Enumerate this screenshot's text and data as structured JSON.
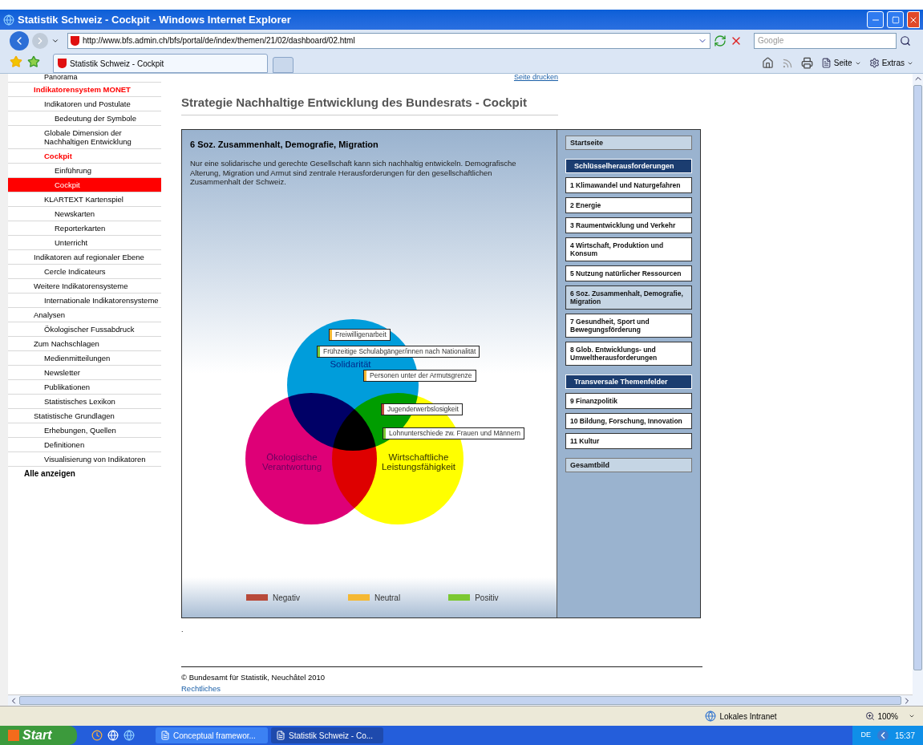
{
  "window": {
    "title": "Statistik Schweiz - Cockpit - Windows Internet Explorer"
  },
  "address_bar": {
    "url": "http://www.bfs.admin.ch/bfs/portal/de/index/themen/21/02/dashboard/02.html",
    "search_placeholder": "Google"
  },
  "tabs": [
    {
      "label": "Statistik Schweiz - Cockpit",
      "selected": true
    }
  ],
  "command_bar": [
    "Seite",
    "Extras"
  ],
  "page": {
    "print_link": "Seite drucken",
    "title": "Strategie Nachhaltige Entwicklung des Bundesrats - Cockpit",
    "sidebar": {
      "clipped_item": "Panorama",
      "items": [
        {
          "label": "Indikatorensystem MONET",
          "selected": false,
          "children": [
            {
              "label": "Indikatoren und Postulate",
              "selected": false,
              "children": [
                {
                  "label": "Bedeutung der Symbole",
                  "selected": false
                }
              ]
            },
            {
              "label": "Globale Dimension der Nachhaltigen Entwicklung",
              "selected": false
            },
            {
              "label": "Cockpit",
              "selected": false,
              "children": [
                {
                  "label": "Einführung",
                  "selected": false
                },
                {
                  "label": "Cockpit",
                  "selected": true
                }
              ]
            },
            {
              "label": "KLARTEXT Kartenspiel",
              "selected": false,
              "children": [
                {
                  "label": "Newskarten",
                  "selected": false
                },
                {
                  "label": "Reporterkarten",
                  "selected": false
                },
                {
                  "label": "Unterricht",
                  "selected": false
                }
              ]
            }
          ]
        },
        {
          "label": "Indikatoren auf regionaler Ebene",
          "selected": false,
          "children": [
            {
              "label": "Cercle Indicateurs",
              "selected": false
            }
          ]
        },
        {
          "label": "Weitere Indikatorensysteme",
          "selected": false,
          "children": [
            {
              "label": "Internationale Indikatorensysteme",
              "selected": false
            }
          ]
        },
        {
          "label": "Analysen",
          "selected": false,
          "children": [
            {
              "label": "Ökologischer Fussabdruck",
              "selected": false
            }
          ]
        },
        {
          "label": "Zum Nachschlagen",
          "selected": false,
          "children": [
            {
              "label": "Medienmitteilungen",
              "selected": false
            },
            {
              "label": "Newsletter",
              "selected": false
            },
            {
              "label": "Publikationen",
              "selected": false
            },
            {
              "label": "Statistisches Lexikon",
              "selected": false
            }
          ]
        },
        {
          "label": "Statistische Grundlagen",
          "selected": false,
          "children": [
            {
              "label": "Erhebungen, Quellen",
              "selected": false
            },
            {
              "label": "Definitionen",
              "selected": false
            },
            {
              "label": "Visualisierung von Indikatoren",
              "selected": false
            }
          ]
        }
      ],
      "show_all": "Alle anzeigen"
    },
    "cockpit": {
      "heading": "6 Soz. Zusammenhalt, Demografie, Migration",
      "description": "Nur eine solidarische und gerechte Gesellschaft kann sich nachhaltig entwickeln. Demografische Alterung, Migration und Armut sind zentrale Herausforderungen für den gesellschaftlichen Zusammenhalt der Schweiz.",
      "venn": {
        "circles": [
          {
            "label_lines": [
              "Solidarität"
            ],
            "color": "#009ddb"
          },
          {
            "label_lines": [
              "Ökologische",
              "Verantwortung"
            ],
            "color": "#de0077"
          },
          {
            "label_lines": [
              "Wirtschaftliche",
              "Leistungsfähigkeit"
            ],
            "color": "#ffff00"
          }
        ],
        "indicators": [
          {
            "label": "Freiwilligenarbeit",
            "color": "#f5b833"
          },
          {
            "label": "Frühzeitige Schulabgänger/innen nach Nationalität",
            "color": "#7cc832"
          },
          {
            "label": "Personen unter der Armutsgrenze",
            "color": "#f5b833"
          },
          {
            "label": "Jugenderwerbslosigkeit",
            "color": "#b84a3a"
          },
          {
            "label": "Lohnunterschiede zw. Frauen und Männern",
            "color": "#7cc832"
          }
        ]
      },
      "legend": [
        {
          "label": "Negativ",
          "color": "#b84a3a"
        },
        {
          "label": "Neutral",
          "color": "#f5b833"
        },
        {
          "label": "Positiv",
          "color": "#7cc832"
        }
      ],
      "nav": [
        {
          "kind": "button",
          "label": "Startseite",
          "selected": false
        },
        {
          "kind": "heading",
          "label": "Schlüsselherausforderungen",
          "selected": false
        },
        {
          "kind": "topic",
          "label": "1 Klimawandel und Naturgefahren",
          "selected": false
        },
        {
          "kind": "topic",
          "label": "2 Energie",
          "selected": false
        },
        {
          "kind": "topic",
          "label": "3 Raumentwicklung und Verkehr",
          "selected": false
        },
        {
          "kind": "topic",
          "label": "4 Wirtschaft, Produktion und Konsum",
          "selected": false
        },
        {
          "kind": "topic",
          "label": "5 Nutzung natürlicher Ressourcen",
          "selected": false
        },
        {
          "kind": "topic",
          "label": "6 Soz. Zusammenhalt, Demografie, Migration",
          "selected": true
        },
        {
          "kind": "topic",
          "label": "7 Gesundheit, Sport und Bewegungsförderung",
          "selected": false
        },
        {
          "kind": "topic",
          "label": "8 Glob. Entwicklungs- und Umweltherausforderungen",
          "selected": false
        },
        {
          "kind": "heading",
          "label": "Transversale Themenfelder",
          "selected": false
        },
        {
          "kind": "topic",
          "label": "9 Finanzpolitik",
          "selected": false
        },
        {
          "kind": "topic",
          "label": "10 Bildung, Forschung, Innovation",
          "selected": false
        },
        {
          "kind": "topic",
          "label": "11 Kultur",
          "selected": false
        },
        {
          "kind": "button",
          "label": "Gesamtbild",
          "selected": false
        }
      ]
    },
    "note": ".",
    "footer": {
      "copyright": "© Bundesamt für Statistik, Neuchâtel 2010",
      "link": "Rechtliches"
    }
  },
  "status_bar": {
    "zone": "Lokales Intranet",
    "zoom": "100%"
  },
  "taskbar": {
    "start": "Start",
    "tasks": [
      {
        "label": "Conceptual framewor...",
        "selected": false
      },
      {
        "label": "Statistik Schweiz - Co...",
        "selected": true
      }
    ],
    "language": "DE",
    "clock": "15:37"
  }
}
